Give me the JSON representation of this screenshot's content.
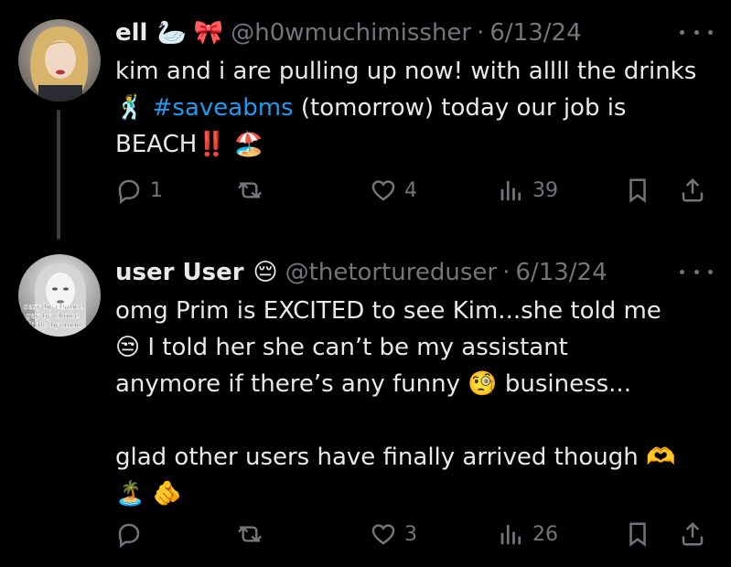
{
  "tweets": [
    {
      "name": "ell",
      "name_emojis": [
        "🦢",
        "🎀"
      ],
      "handle": "@h0wmuchimissher",
      "date": "6/13/24",
      "body_prefix": "kim and i are pulling up now! with allll the drinks\n🕺 ",
      "hashtag": "#saveabms",
      "body_suffix": " (tomorrow) today our job is\nBEACH‼️ 🏖️",
      "replies": "1",
      "reposts": "",
      "likes": "4",
      "views": "39"
    },
    {
      "name": "user User",
      "name_emojis": [
        "😔"
      ],
      "handle": "@thetortureduser",
      "date": "6/13/24",
      "avatar_text": [
        "sexy by chance",
        "gay by choice",
        "little by mind"
      ],
      "body": "omg Prim is EXCITED to see Kim...she told me\n😒 I told her she can’t be my assistant\nanymore if there’s any funny 🧐 business...\n\nglad other users have finally arrived though 🫶\n🏝️ 🫵",
      "replies": "",
      "reposts": "",
      "likes": "3",
      "views": "26"
    }
  ],
  "colors": {
    "background": "#000000",
    "text": "#e7e9ea",
    "secondary": "#71767b",
    "link": "#1d9bf0",
    "thread_line": "#3a3d41"
  },
  "icons": [
    "reply-icon",
    "repost-icon",
    "like-icon",
    "views-icon",
    "bookmark-icon",
    "share-icon",
    "more-icon"
  ]
}
